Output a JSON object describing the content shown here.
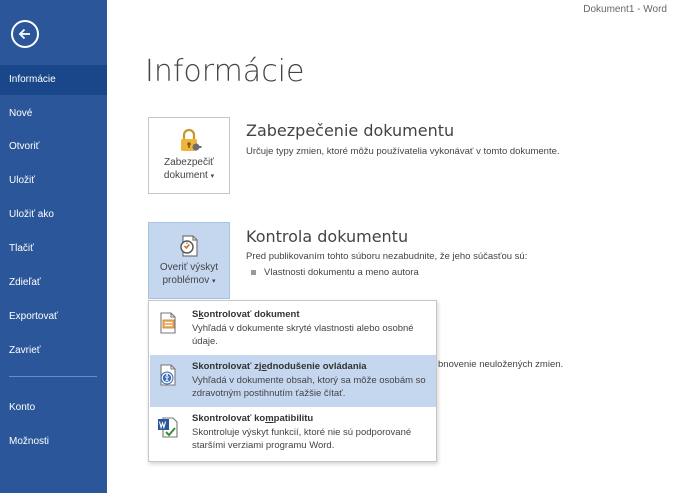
{
  "titlebar": {
    "text": "Dokument1 - Word"
  },
  "sidebar": {
    "items": [
      {
        "label": "Informácie",
        "active": true
      },
      {
        "label": "Nové"
      },
      {
        "label": "Otvoriť"
      },
      {
        "label": "Uložiť"
      },
      {
        "label": "Uložiť ako"
      },
      {
        "label": "Tlačiť"
      },
      {
        "label": "Zdieľať"
      },
      {
        "label": "Exportovať"
      },
      {
        "label": "Zavrieť"
      },
      {
        "label": "Konto"
      },
      {
        "label": "Možnosti"
      }
    ]
  },
  "page": {
    "title": "Informácie"
  },
  "protect": {
    "tile_line1": "Zabezpečiť",
    "tile_line2": "dokument",
    "caret": "▾",
    "heading": "Zabezpečenie dokumentu",
    "description": "Určuje typy zmien, ktoré môžu používatelia vykonávať v tomto dokumente."
  },
  "inspect": {
    "tile_line1": "Overiť výskyt",
    "tile_line2": "problémov",
    "caret": "▾",
    "heading": "Kontrola dokumentu",
    "description": "Pred publikovaním tohto súboru nezabudnite, že jeho súčasťou sú:",
    "bullet": "Vlastnosti dokumentu a meno autora"
  },
  "versions": {
    "partial_text": "bnovenie neuložených zmien."
  },
  "dropdown": {
    "items": [
      {
        "title_pre": "S",
        "title_ul": "k",
        "title_post": "ontrolovať dokument",
        "desc": "Vyhľadá v dokumente skryté vlastnosti alebo osobné údaje."
      },
      {
        "title_pre": "Skontrolovať zj",
        "title_ul": "e",
        "title_post": "dnodušenie ovládania",
        "desc": "Vyhľadá v dokumente obsah, ktorý sa môže osobám so zdravotným postihnutím ťažšie čítať."
      },
      {
        "title_pre": "Skontrolovať ko",
        "title_ul": "m",
        "title_post": "patibilitu",
        "desc": "Skontroluje výskyt funkcií, ktoré nie sú podporované staršími verziami programu Word."
      }
    ]
  }
}
